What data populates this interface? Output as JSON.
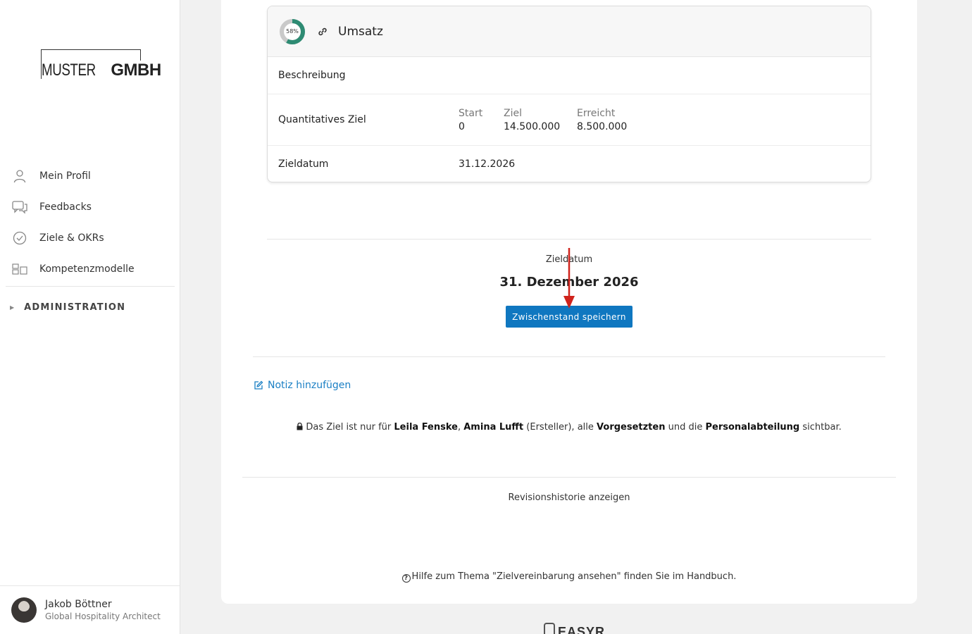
{
  "brand": {
    "logo_light": "MUSTER",
    "logo_bold": "GMBH"
  },
  "sidebar": {
    "items": [
      {
        "label": "Mein Profil",
        "icon": "user-icon"
      },
      {
        "label": "Feedbacks",
        "icon": "chat-icon"
      },
      {
        "label": "Ziele & OKRs",
        "icon": "check-circle-icon"
      },
      {
        "label": "Kompetenzmodelle",
        "icon": "blocks-icon"
      }
    ],
    "admin_label": "ADMINISTRATION"
  },
  "user": {
    "name": "Jakob Böttner",
    "role": "Global Hospitality Architect"
  },
  "goal_card": {
    "progress_label": "58%",
    "progress_fraction": 0.58,
    "title": "Umsatz",
    "rows": {
      "description_label": "Beschreibung",
      "quant_label": "Quantitatives Ziel",
      "start_label": "Start",
      "start_value": "0",
      "target_label": "Ziel",
      "target_value": "14.500.000",
      "achieved_label": "Erreicht",
      "achieved_value": "8.500.000",
      "date_label": "Zieldatum",
      "date_value": "31.12.2026"
    }
  },
  "target_date": {
    "label": "Zieldatum",
    "value": "31. Dezember 2026",
    "save_button": "Zwischenstand speichern"
  },
  "note_link": "Notiz hinzufügen",
  "visibility": {
    "prefix": "Das Ziel ist nur für",
    "person1": "Leila Fenske",
    "person2": "Amina Lufft",
    "creator_suffix": "(Ersteller), alle",
    "group1": "Vorgesetzten",
    "and": "und die",
    "group2": "Personalabteilung",
    "suffix": "sichtbar."
  },
  "revision_link": "Revisionshistorie anzeigen",
  "help_text": "Hilfe zum Thema \"Zielvereinbarung ansehen\" finden Sie im Handbuch.",
  "footer_logo": "EASYR",
  "colors": {
    "primary": "#0f77c0",
    "progress": "#2e8b73",
    "link": "#1a7fc4",
    "arrow": "#d0231c"
  }
}
